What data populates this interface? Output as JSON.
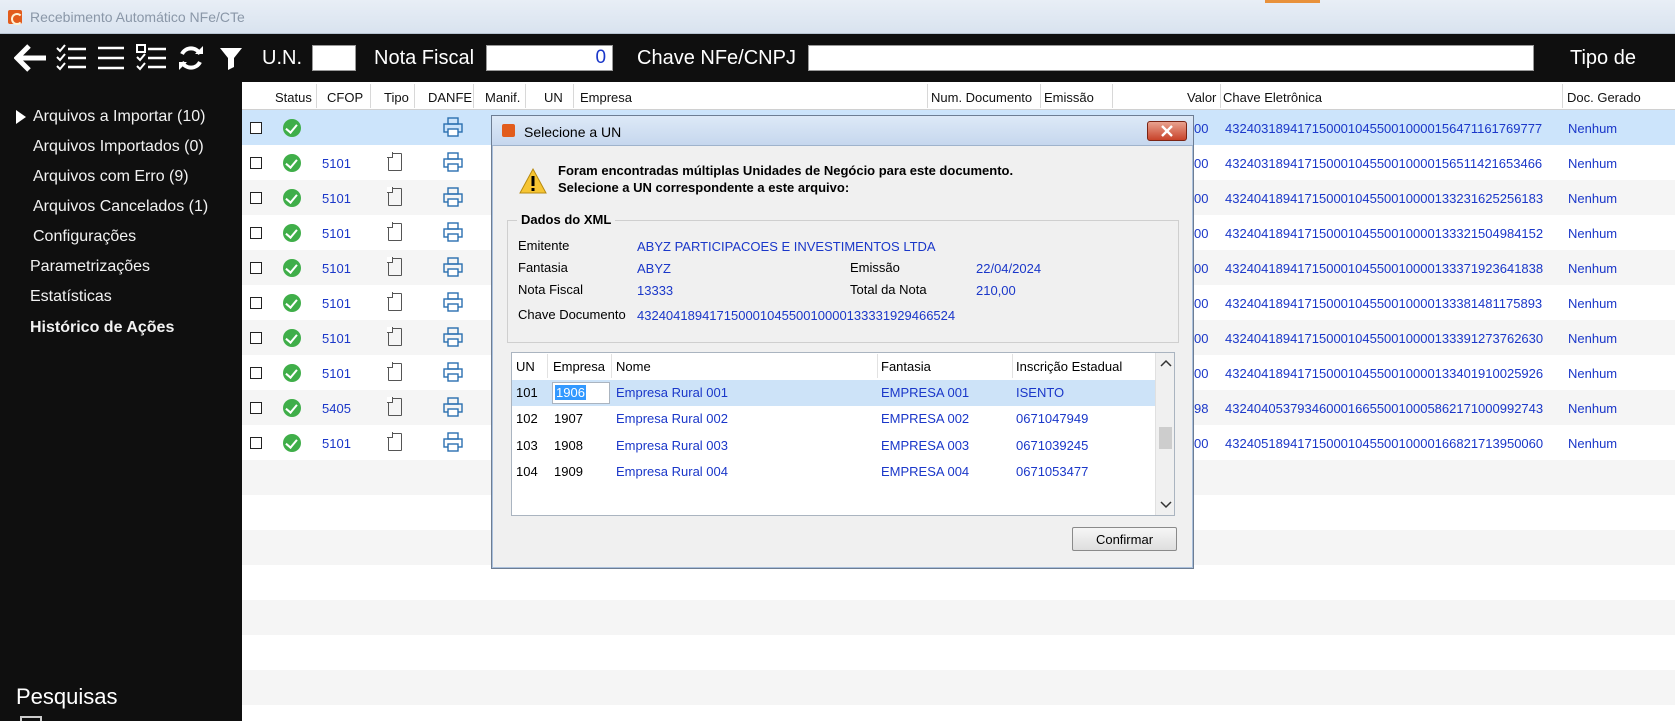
{
  "window": {
    "title": "Recebimento Automático NFe/CTe"
  },
  "toolbar": {
    "un_label": "U.N.",
    "un_value": "",
    "nota_label": "Nota Fiscal",
    "nota_value": "0",
    "chave_label": "Chave NFe/CNPJ",
    "chave_value": "",
    "tipo_label": "Tipo de"
  },
  "sidebar": {
    "items": [
      {
        "label": "Arquivos a Importar (10)"
      },
      {
        "label": "Arquivos Importados (0)"
      },
      {
        "label": "Arquivos com Erro (9)"
      },
      {
        "label": "Arquivos Cancelados (1)"
      },
      {
        "label": "Configurações"
      },
      {
        "label": "Parametrizações"
      },
      {
        "label": "Estatísticas"
      },
      {
        "label": "Histórico de Ações"
      }
    ],
    "pesquisas": "Pesquisas"
  },
  "grid": {
    "columns": [
      "Status",
      "CFOP",
      "Tipo",
      "DANFE",
      "Manif.",
      "UN",
      "Empresa",
      "Num. Documento",
      "Emissão",
      "Valor",
      "Chave Eletrônica",
      "Doc. Gerado"
    ],
    "rows": [
      {
        "cfop": "",
        "valor": "00",
        "chave": "43240318941715000104550010000156471161769777",
        "doc": "Nenhum"
      },
      {
        "cfop": "5101",
        "valor": "00",
        "chave": "43240318941715000104550010000156511421653466",
        "doc": "Nenhum"
      },
      {
        "cfop": "5101",
        "valor": "00",
        "chave": "43240418941715000104550010000133231625256183",
        "doc": "Nenhum"
      },
      {
        "cfop": "5101",
        "valor": "00",
        "chave": "43240418941715000104550010000133321504984152",
        "doc": "Nenhum"
      },
      {
        "cfop": "5101",
        "valor": "00",
        "chave": "43240418941715000104550010000133371923641838",
        "doc": "Nenhum"
      },
      {
        "cfop": "5101",
        "valor": "00",
        "chave": "43240418941715000104550010000133381481175893",
        "doc": "Nenhum"
      },
      {
        "cfop": "5101",
        "valor": "00",
        "chave": "43240418941715000104550010000133391273762630",
        "doc": "Nenhum"
      },
      {
        "cfop": "5101",
        "valor": "00",
        "chave": "43240418941715000104550010000133401910025926",
        "doc": "Nenhum"
      },
      {
        "cfop": "5405",
        "valor": "98",
        "chave": "43240405379346000166550010005862171000992743",
        "doc": "Nenhum"
      },
      {
        "cfop": "5101",
        "valor": "00",
        "chave": "43240518941715000104550010000166821713950060",
        "doc": "Nenhum"
      }
    ]
  },
  "dialog": {
    "title": "Selecione a UN",
    "message_line1": "Foram encontradas múltiplas Unidades de Negócio para este documento.",
    "message_line2": "Selecione a UN correspondente a este arquivo:",
    "xml_group": "Dados do XML",
    "fields": {
      "emitente_label": "Emitente",
      "emitente_value": "ABYZ PARTICIPACOES E INVESTIMENTOS LTDA",
      "fantasia_label": "Fantasia",
      "fantasia_value": "ABYZ",
      "emissao_label": "Emissão",
      "emissao_value": "22/04/2024",
      "nota_label": "Nota Fiscal",
      "nota_value": "13333",
      "total_label": "Total da Nota",
      "total_value": "210,00",
      "chave_label": "Chave Documento",
      "chave_value": "43240418941715000104550010000133331929466524"
    },
    "list_columns": [
      "UN",
      "Empresa",
      "Nome",
      "Fantasia",
      "Inscrição Estadual"
    ],
    "list_rows": [
      {
        "un": "101",
        "empresa": "1906",
        "nome": "Empresa Rural 001",
        "fantasia": "EMPRESA 001",
        "ie": "ISENTO"
      },
      {
        "un": "102",
        "empresa": "1907",
        "nome": "Empresa Rural 002",
        "fantasia": "EMPRESA 002",
        "ie": "0671047949"
      },
      {
        "un": "103",
        "empresa": "1908",
        "nome": "Empresa Rural 003",
        "fantasia": "EMPRESA 003",
        "ie": "0671039245"
      },
      {
        "un": "104",
        "empresa": "1909",
        "nome": "Empresa Rural 004",
        "fantasia": "EMPRESA 004",
        "ie": "0671053477"
      }
    ],
    "confirm_label": "Confirmar"
  }
}
